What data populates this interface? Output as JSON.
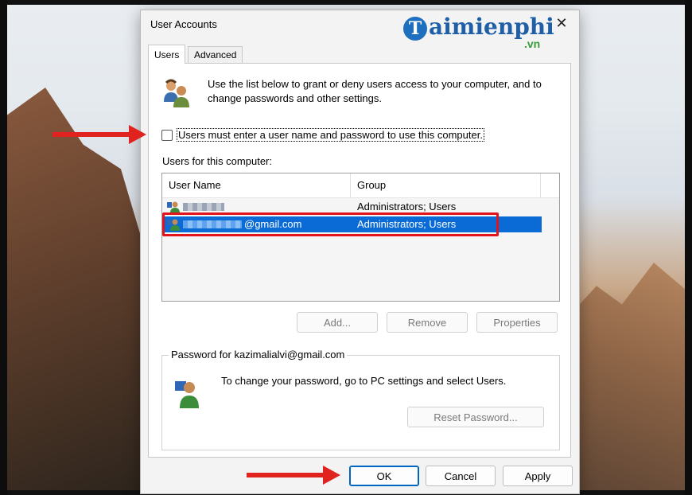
{
  "window": {
    "title": "User Accounts",
    "close_glyph": "✕"
  },
  "watermark": {
    "letter": "T",
    "text": "aimienphi",
    "suffix": ".vn"
  },
  "tabs": [
    {
      "label": "Users",
      "active": true
    },
    {
      "label": "Advanced",
      "active": false
    }
  ],
  "intro": "Use the list below to grant or deny users access to your computer, and to change passwords and other settings.",
  "require_login": {
    "label": "Users must enter a user name and password to use this computer.",
    "checked": false
  },
  "users_section": {
    "label": "Users for this computer:",
    "columns": [
      "User Name",
      "Group"
    ],
    "rows": [
      {
        "name": "",
        "group": "Administrators; Users",
        "selected": false
      },
      {
        "name": "@gmail.com",
        "group": "Administrators; Users",
        "selected": true
      }
    ]
  },
  "list_buttons": {
    "add": "Add...",
    "remove": "Remove",
    "properties": "Properties"
  },
  "password_group": {
    "legend": "Password for kazimalialvi@gmail.com",
    "text": "To change your password, go to PC settings and select Users.",
    "reset": "Reset Password..."
  },
  "footer": {
    "ok": "OK",
    "cancel": "Cancel",
    "apply": "Apply"
  },
  "colors": {
    "selection": "#0a6bd6",
    "highlight_box": "#e2141b",
    "arrow": "#e0231f",
    "logo_blue": "#1e5fa8"
  },
  "icons": [
    "users-icon",
    "user-row-icon",
    "user-password-icon",
    "close-icon",
    "pointer-arrow"
  ]
}
